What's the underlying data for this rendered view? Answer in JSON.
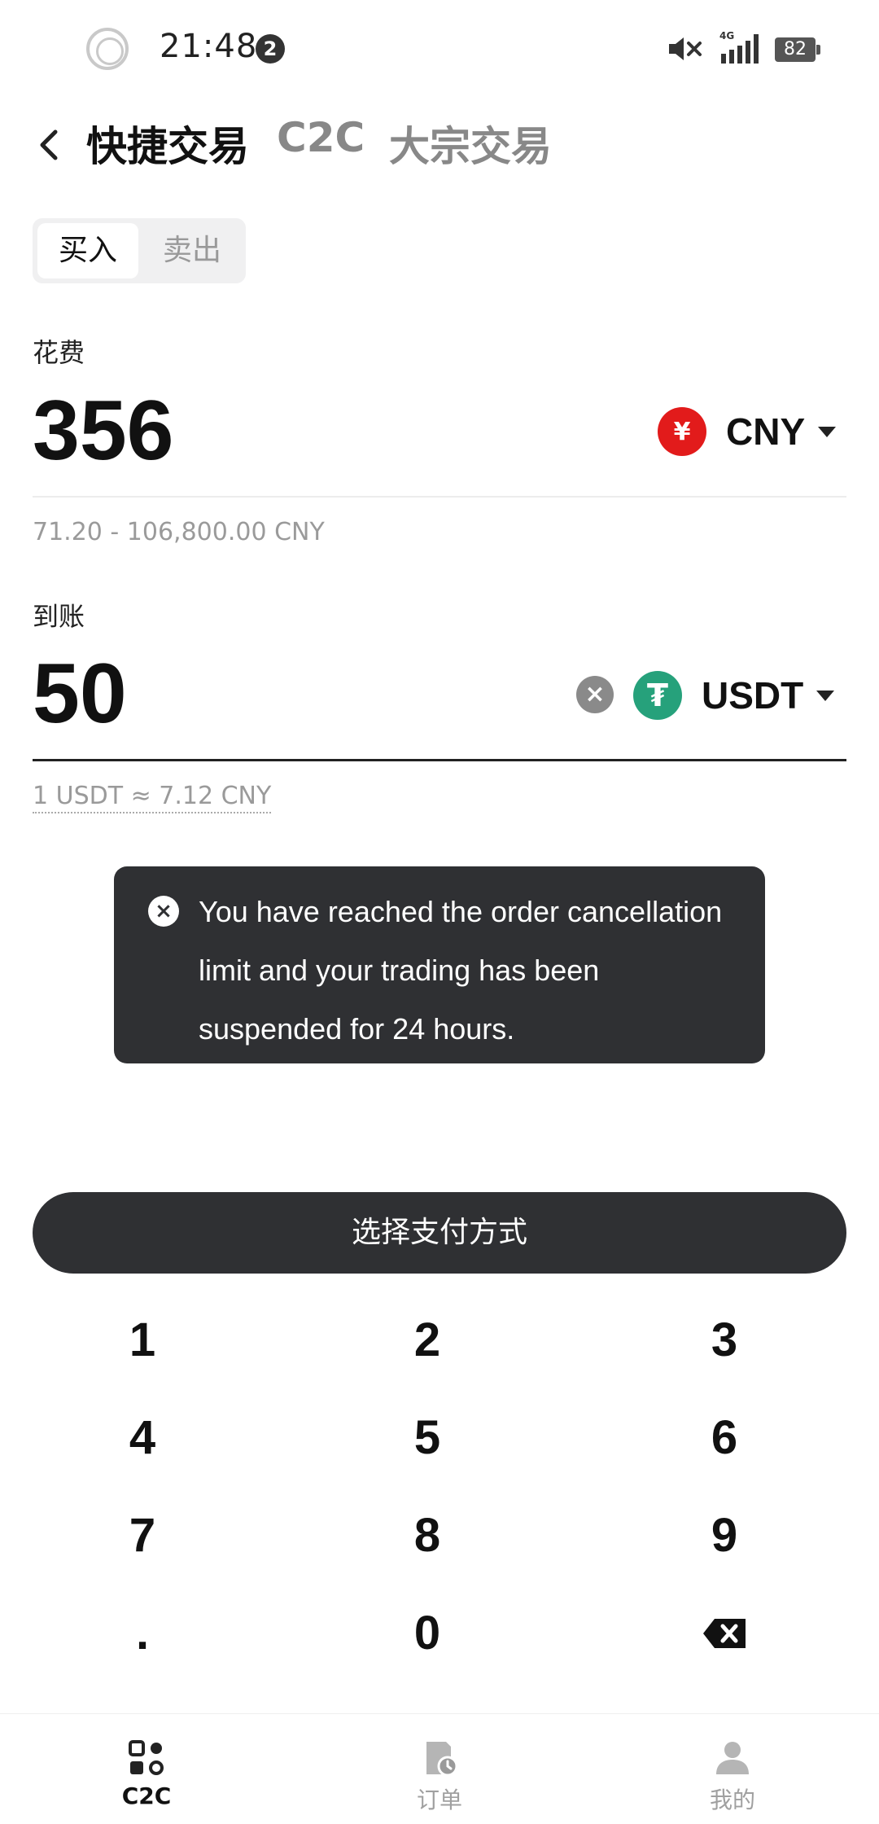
{
  "status_bar": {
    "time": "21:48",
    "notification_count": "2",
    "network": "4G",
    "battery": "82"
  },
  "header": {
    "tabs": [
      {
        "label": "快捷交易",
        "active": true
      },
      {
        "label": "C2C",
        "active": false
      },
      {
        "label": "大宗交易",
        "active": false
      }
    ]
  },
  "segment": {
    "buy_label": "买入",
    "sell_label": "卖出",
    "selected": "买入"
  },
  "spend": {
    "label": "花费",
    "amount": "356",
    "currency": "CNY",
    "currency_symbol": "¥",
    "range": "71.20 - 106,800.00 CNY"
  },
  "receive": {
    "label": "到账",
    "amount": "50",
    "currency": "USDT",
    "currency_symbol": "₮",
    "rate": "1 USDT ≈ 7.12 CNY"
  },
  "toast": {
    "message": "You have reached the order cancellation limit and your trading has been suspended for 24 hours."
  },
  "primary_button": {
    "label": "选择支付方式"
  },
  "keypad": {
    "keys": [
      "1",
      "2",
      "3",
      "4",
      "5",
      "6",
      "7",
      "8",
      "9",
      ".",
      "0"
    ],
    "backspace_icon": "backspace-icon"
  },
  "bottom_nav": {
    "items": [
      {
        "label": "C2C",
        "icon": "c2c-icon",
        "active": true
      },
      {
        "label": "订单",
        "icon": "orders-icon",
        "active": false
      },
      {
        "label": "我的",
        "icon": "profile-icon",
        "active": false
      }
    ]
  },
  "colors": {
    "dark": "#2f3033",
    "cny_red": "#e21b1b",
    "usdt_green": "#26a17b",
    "muted_text": "#9a9a9a"
  }
}
